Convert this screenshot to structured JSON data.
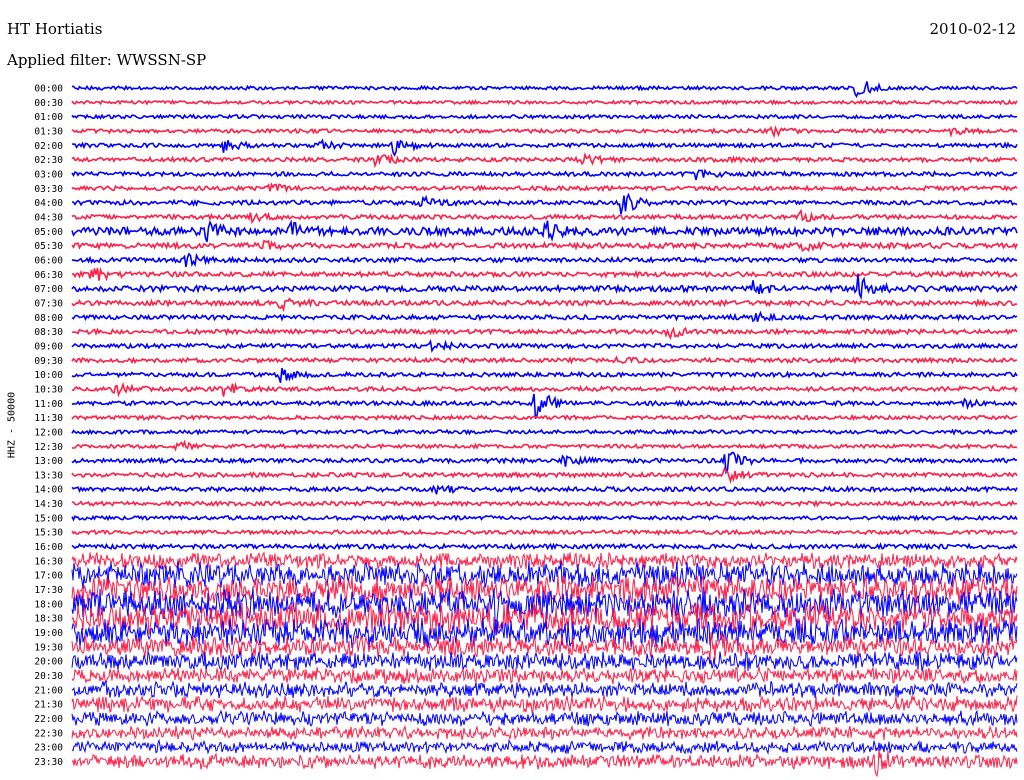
{
  "header": {
    "station": "HT Hortiatis",
    "date": "2010-02-12",
    "filter": "Applied filter: WWSSN-SP",
    "channel": "HHZ - 50000"
  },
  "chart_data": {
    "type": "line",
    "title": "HT Hortiatis",
    "ylabel": "HHZ - 50000",
    "colors": [
      "#0000ff",
      "#ff1e46"
    ],
    "rows": [
      {
        "label": "00:00",
        "level": 0.5,
        "events": [
          {
            "x": 0.83,
            "amp": 12
          }
        ]
      },
      {
        "label": "00:30",
        "level": 0.4,
        "events": []
      },
      {
        "label": "01:00",
        "level": 0.5,
        "events": []
      },
      {
        "label": "01:30",
        "level": 0.6,
        "events": [
          {
            "x": 0.93,
            "amp": 4
          },
          {
            "x": 0.74,
            "amp": 4
          }
        ]
      },
      {
        "label": "02:00",
        "level": 0.8,
        "events": [
          {
            "x": 0.16,
            "amp": 6
          },
          {
            "x": 0.26,
            "amp": 5
          },
          {
            "x": 0.34,
            "amp": 10
          }
        ]
      },
      {
        "label": "02:30",
        "level": 0.9,
        "events": [
          {
            "x": 0.32,
            "amp": 7
          },
          {
            "x": 0.54,
            "amp": 6
          }
        ]
      },
      {
        "label": "03:00",
        "level": 0.9,
        "events": [
          {
            "x": 0.66,
            "amp": 5
          }
        ]
      },
      {
        "label": "03:30",
        "level": 0.8,
        "events": [
          {
            "x": 0.21,
            "amp": 4
          }
        ]
      },
      {
        "label": "04:00",
        "level": 1.0,
        "events": [
          {
            "x": 0.37,
            "amp": 5
          },
          {
            "x": 0.58,
            "amp": 14
          }
        ]
      },
      {
        "label": "04:30",
        "level": 0.9,
        "events": [
          {
            "x": 0.19,
            "amp": 5
          },
          {
            "x": 0.77,
            "amp": 5
          }
        ]
      },
      {
        "label": "05:00",
        "level": 2.6,
        "events": [
          {
            "x": 0.14,
            "amp": 10
          },
          {
            "x": 0.23,
            "amp": 8
          },
          {
            "x": 0.5,
            "amp": 9
          }
        ]
      },
      {
        "label": "05:30",
        "level": 1.4,
        "events": [
          {
            "x": 0.2,
            "amp": 6
          },
          {
            "x": 0.77,
            "amp": 5
          }
        ]
      },
      {
        "label": "06:00",
        "level": 1.0,
        "events": [
          {
            "x": 0.12,
            "amp": 6
          }
        ]
      },
      {
        "label": "06:30",
        "level": 1.2,
        "events": [
          {
            "x": 0.02,
            "amp": 10
          }
        ]
      },
      {
        "label": "07:00",
        "level": 1.6,
        "events": [
          {
            "x": 0.83,
            "amp": 14
          },
          {
            "x": 0.72,
            "amp": 6
          }
        ]
      },
      {
        "label": "07:30",
        "level": 1.2,
        "events": [
          {
            "x": 0.22,
            "amp": 6
          }
        ]
      },
      {
        "label": "08:00",
        "level": 1.0,
        "events": [
          {
            "x": 0.72,
            "amp": 5
          }
        ]
      },
      {
        "label": "08:30",
        "level": 1.0,
        "events": [
          {
            "x": 0.63,
            "amp": 7
          }
        ]
      },
      {
        "label": "09:00",
        "level": 0.9,
        "events": [
          {
            "x": 0.38,
            "amp": 5
          }
        ]
      },
      {
        "label": "09:30",
        "level": 0.9,
        "events": [
          {
            "x": 0.57,
            "amp": 4
          }
        ]
      },
      {
        "label": "10:00",
        "level": 0.9,
        "events": [
          {
            "x": 0.22,
            "amp": 8
          }
        ]
      },
      {
        "label": "10:30",
        "level": 0.9,
        "events": [
          {
            "x": 0.04,
            "amp": 8
          },
          {
            "x": 0.16,
            "amp": 7
          }
        ]
      },
      {
        "label": "11:00",
        "level": 0.8,
        "events": [
          {
            "x": 0.49,
            "amp": 18
          },
          {
            "x": 0.94,
            "amp": 4
          }
        ]
      },
      {
        "label": "11:30",
        "level": 0.7,
        "events": []
      },
      {
        "label": "12:00",
        "level": 0.6,
        "events": []
      },
      {
        "label": "12:30",
        "level": 0.6,
        "events": [
          {
            "x": 0.11,
            "amp": 5
          }
        ]
      },
      {
        "label": "13:00",
        "level": 0.9,
        "events": [
          {
            "x": 0.69,
            "amp": 16
          },
          {
            "x": 0.52,
            "amp": 5
          }
        ]
      },
      {
        "label": "13:30",
        "level": 0.9,
        "events": [
          {
            "x": 0.69,
            "amp": 8
          }
        ]
      },
      {
        "label": "14:00",
        "level": 1.0,
        "events": [
          {
            "x": 0.38,
            "amp": 6
          }
        ]
      },
      {
        "label": "14:30",
        "level": 0.8,
        "events": []
      },
      {
        "label": "15:00",
        "level": 0.7,
        "events": []
      },
      {
        "label": "15:30",
        "level": 0.7,
        "events": []
      },
      {
        "label": "16:00",
        "level": 1.0,
        "events": []
      },
      {
        "label": "16:30",
        "level": 5.0,
        "events": []
      },
      {
        "label": "17:00",
        "level": 9.0,
        "events": []
      },
      {
        "label": "17:30",
        "level": 10.0,
        "events": []
      },
      {
        "label": "18:00",
        "level": 11.0,
        "events": []
      },
      {
        "label": "18:30",
        "level": 11.0,
        "events": []
      },
      {
        "label": "19:00",
        "level": 10.0,
        "events": []
      },
      {
        "label": "19:30",
        "level": 7.0,
        "events": [
          {
            "x": 0.67,
            "amp": 12
          }
        ]
      },
      {
        "label": "20:00",
        "level": 6.0,
        "events": []
      },
      {
        "label": "20:30",
        "level": 5.0,
        "events": []
      },
      {
        "label": "21:00",
        "level": 5.0,
        "events": []
      },
      {
        "label": "21:30",
        "level": 5.0,
        "events": []
      },
      {
        "label": "22:00",
        "level": 4.5,
        "events": []
      },
      {
        "label": "22:30",
        "level": 4.0,
        "events": []
      },
      {
        "label": "23:00",
        "level": 3.5,
        "events": []
      },
      {
        "label": "23:30",
        "level": 4.5,
        "events": [
          {
            "x": 0.85,
            "amp": 8
          }
        ]
      }
    ]
  }
}
